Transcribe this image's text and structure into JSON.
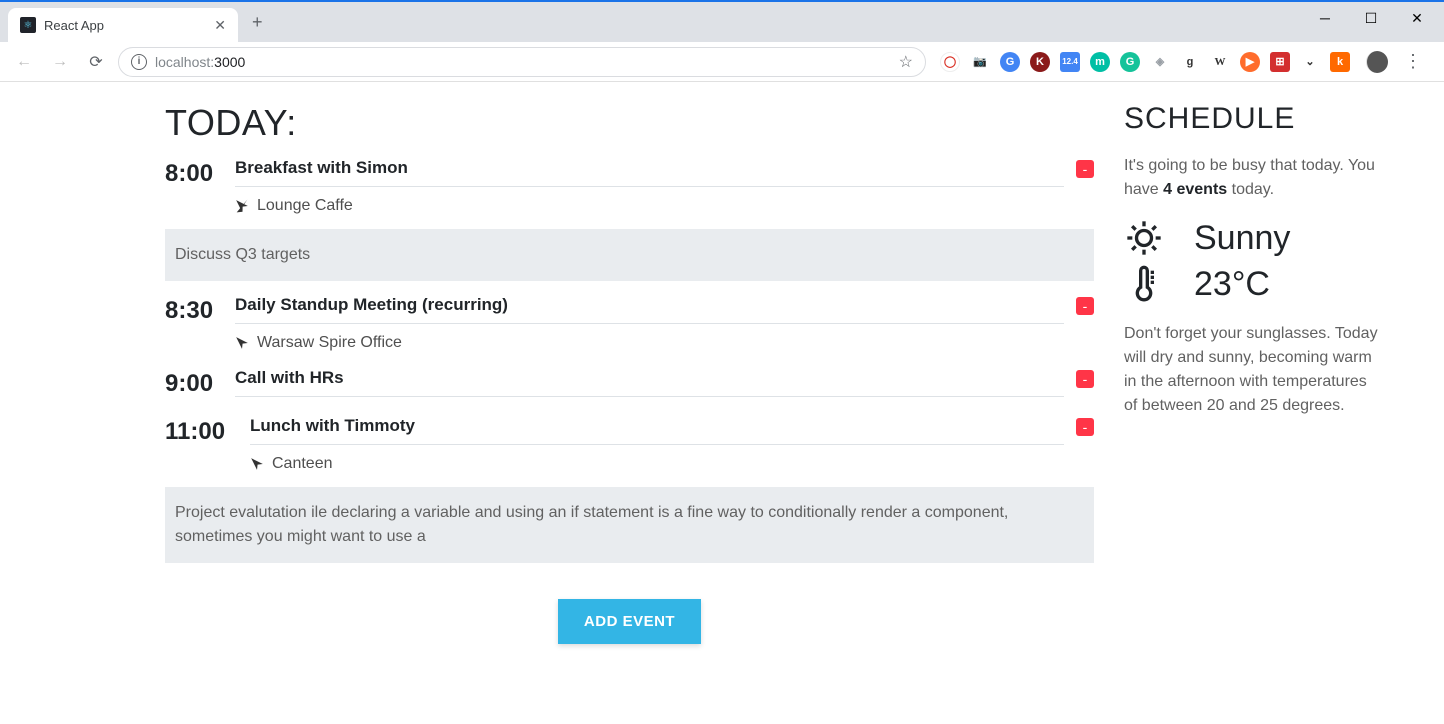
{
  "browser": {
    "tab_title": "React App",
    "url_host_dim": "localhost:",
    "url_port": "3000"
  },
  "page": {
    "heading": "TODAY:",
    "add_event_label": "ADD EVENT",
    "events": [
      {
        "time": "8:00",
        "title": "Breakfast with Simon",
        "location": "Lounge Caffe",
        "note": "Discuss Q3 targets"
      },
      {
        "time": "8:30",
        "title": "Daily Standup Meeting (recurring)",
        "location": "Warsaw Spire Office",
        "note": null
      },
      {
        "time": "9:00",
        "title": "Call with HRs",
        "location": null,
        "note": null
      },
      {
        "time": "11:00",
        "title": "Lunch with Timmoty",
        "location": "Canteen",
        "note": "Project evalutation ile declaring a variable and using an if statement is a fine way to conditionally render a component, sometimes you might want to use a"
      }
    ]
  },
  "schedule": {
    "heading": "SCHEDULE",
    "intro_pre": "It's going to be busy that today. You have ",
    "intro_strong": "4 events",
    "intro_post": " today.",
    "weather_condition": "Sunny",
    "weather_temp": "23°C",
    "forecast": "Don't forget your sunglasses. Today will dry and sunny, becoming warm in the afternoon with temperatures of between 20 and 25 degrees."
  }
}
